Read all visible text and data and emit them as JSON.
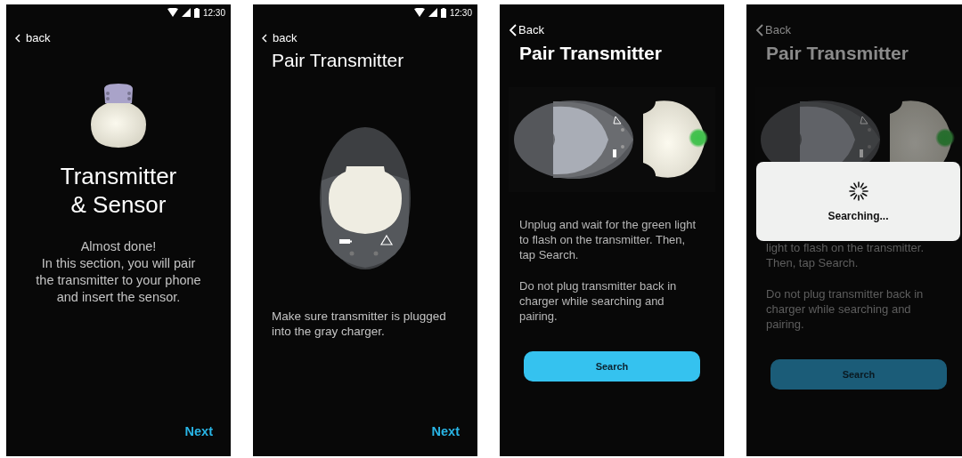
{
  "screens": [
    {
      "kind": "welcome",
      "dimmed": false,
      "status_bar": {
        "time": "12:30"
      },
      "back": {
        "label": "back"
      },
      "title": "Transmitter\n& Sensor",
      "paragraphs": [
        "Almost done!\nIn this section, you will pair the transmitter to your phone and insert the sensor."
      ],
      "action": {
        "kind": "text-link",
        "label": "Next"
      }
    },
    {
      "kind": "charger",
      "dimmed": false,
      "status_bar": {
        "time": "12:30"
      },
      "back": {
        "label": "back"
      },
      "title": "Pair Transmitter",
      "paragraphs": [
        "Make sure transmitter is plugged into the gray charger."
      ],
      "action": {
        "kind": "text-link",
        "label": "Next"
      }
    },
    {
      "kind": "pairing",
      "dimmed": false,
      "back": {
        "label": "Back"
      },
      "title": "Pair Transmitter",
      "paragraphs": [
        "Unplug and wait for the green light to flash on the transmitter. Then, tap Search.",
        "Do not plug transmitter back in charger while searching and pairing."
      ],
      "action": {
        "kind": "pill",
        "label": "Search"
      }
    },
    {
      "kind": "pairing",
      "dimmed": true,
      "back": {
        "label": "Back"
      },
      "title": "Pair Transmitter",
      "paragraphs": [
        "light to flash on the transmitter. Then, tap Search.",
        "Do not plug transmitter back in charger while searching and pairing."
      ],
      "action": {
        "kind": "pill",
        "label": "Search"
      },
      "modal": {
        "text": "Searching..."
      }
    }
  ]
}
